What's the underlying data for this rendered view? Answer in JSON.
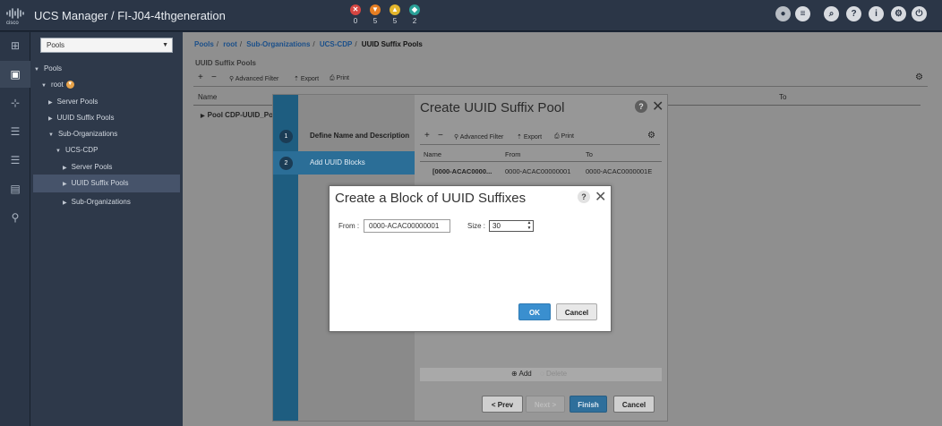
{
  "header": {
    "title": "UCS Manager / FI-J04-4thgeneration",
    "faults": [
      {
        "icon": "critical-fault-icon",
        "count": "0",
        "color": "#d64541"
      },
      {
        "icon": "major-fault-icon",
        "count": "5",
        "color": "#e67e22"
      },
      {
        "icon": "minor-fault-icon",
        "count": "5",
        "color": "#e3b52c"
      },
      {
        "icon": "warning-fault-icon",
        "count": "2",
        "color": "#2aa198"
      }
    ],
    "right_icons": [
      "user-status-icon",
      "menu-icon",
      "search-icon",
      "help-icon",
      "info-icon",
      "settings-icon",
      "logout-icon"
    ]
  },
  "rail": {
    "icons": [
      "equipment-icon",
      "servers-icon",
      "lan-icon",
      "san-icon",
      "vm-icon",
      "storage-icon",
      "admin-icon"
    ]
  },
  "tree": {
    "select_value": "Pools",
    "nodes": {
      "pools": "Pools",
      "root": "root",
      "server_pools": "Server Pools",
      "uuid_suffix_pools": "UUID Suffix Pools",
      "sub_orgs": "Sub-Organizations",
      "ucs_cdp": "UCS-CDP",
      "ucs_cdp_server_pools": "Server Pools",
      "ucs_cdp_uuid_suffix_pools": "UUID Suffix Pools",
      "ucs_cdp_sub_orgs": "Sub-Organizations"
    }
  },
  "main": {
    "breadcrumb": [
      "Pools",
      "root",
      "Sub-Organizations",
      "UCS-CDP",
      "UUID Suffix Pools"
    ],
    "section_title": "UUID Suffix Pools",
    "toolbar": {
      "add": "+",
      "remove": "−",
      "filter": "Advanced Filter",
      "export": "Export",
      "print": "Print"
    },
    "columns": {
      "name": "Name",
      "to": "To"
    },
    "row": "Pool CDP-UUID_Po"
  },
  "wizard": {
    "title": "Create UUID Suffix Pool",
    "steps": [
      {
        "num": "1",
        "label": "Define Name and Description"
      },
      {
        "num": "2",
        "label": "Add UUID Blocks"
      }
    ],
    "toolbar": {
      "add": "+",
      "remove": "−",
      "filter": "Advanced Filter",
      "export": "Export",
      "print": "Print"
    },
    "columns": {
      "name": "Name",
      "from": "From",
      "to": "To"
    },
    "row": {
      "name": "[0000-ACAC0000...",
      "from": "0000-ACAC00000001",
      "to": "0000-ACAC0000001E"
    },
    "add_label": "Add",
    "delete_label": "Delete",
    "buttons": {
      "prev": "< Prev",
      "next": "Next >",
      "finish": "Finish",
      "cancel": "Cancel"
    }
  },
  "dialog": {
    "title": "Create a Block of UUID Suffixes",
    "from_label": "From :",
    "from_value": "0000-ACAC00000001",
    "size_label": "Size :",
    "size_value": "30",
    "ok": "OK",
    "cancel": "Cancel"
  }
}
